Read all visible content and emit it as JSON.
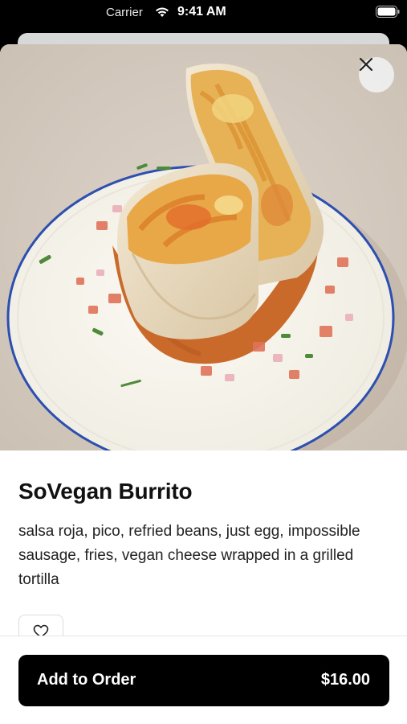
{
  "status_bar": {
    "carrier": "Carrier",
    "time": "9:41 AM",
    "wifi_icon": "wifi-icon",
    "battery_icon": "battery-icon"
  },
  "hero": {
    "image_icon": "burrito-photo",
    "close_icon": "close-icon"
  },
  "item": {
    "title": "SoVegan Burrito",
    "description": "salsa roja, pico, refried beans, just egg, impossible sausage, fries, vegan cheese wrapped in a grilled tortilla"
  },
  "favorite": {
    "icon": "heart-icon"
  },
  "order": {
    "label": "Add to Order",
    "price": "$16.00"
  },
  "colors": {
    "button_bg": "#000000",
    "button_text": "#ffffff",
    "title_text": "#111111"
  }
}
